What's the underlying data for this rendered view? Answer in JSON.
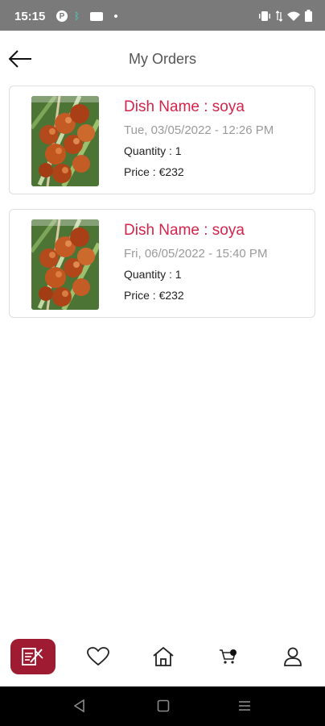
{
  "status_bar": {
    "time": "15:15",
    "left_icons": [
      "p-circle-icon",
      "bluetooth-icon",
      "notification-box-icon",
      "dot-icon"
    ],
    "right_icons": [
      "vibrate-icon",
      "data-arrows-icon",
      "wifi-icon",
      "battery-icon"
    ]
  },
  "header": {
    "title": "My Orders",
    "back_icon": "arrow-left-icon"
  },
  "orders": [
    {
      "dish_name": "Dish Name : soya",
      "date": "Tue, 03/05/2022 - 12:26 PM",
      "quantity": "Quantity : 1",
      "price": "Price : €232",
      "image": "shrimp-skewer-image"
    },
    {
      "dish_name": "Dish Name : soya",
      "date": "Fri, 06/05/2022 - 15:40 PM",
      "quantity": "Quantity : 1",
      "price": "Price : €232",
      "image": "shrimp-skewer-image"
    }
  ],
  "bottom_nav": {
    "items": [
      {
        "icon": "orders-icon",
        "active": true
      },
      {
        "icon": "heart-icon",
        "active": false
      },
      {
        "icon": "home-icon",
        "active": false
      },
      {
        "icon": "cart-icon",
        "active": false,
        "badge_dot": true
      },
      {
        "icon": "user-icon",
        "active": false
      }
    ]
  },
  "system_nav": {
    "buttons": [
      "back-triangle-icon",
      "home-square-icon",
      "recents-lines-icon"
    ]
  },
  "colors": {
    "accent": "#9e1b32",
    "dish_name": "#d6234b",
    "status_bar": "#7a7a7a",
    "date_text": "#9a9a9a"
  }
}
